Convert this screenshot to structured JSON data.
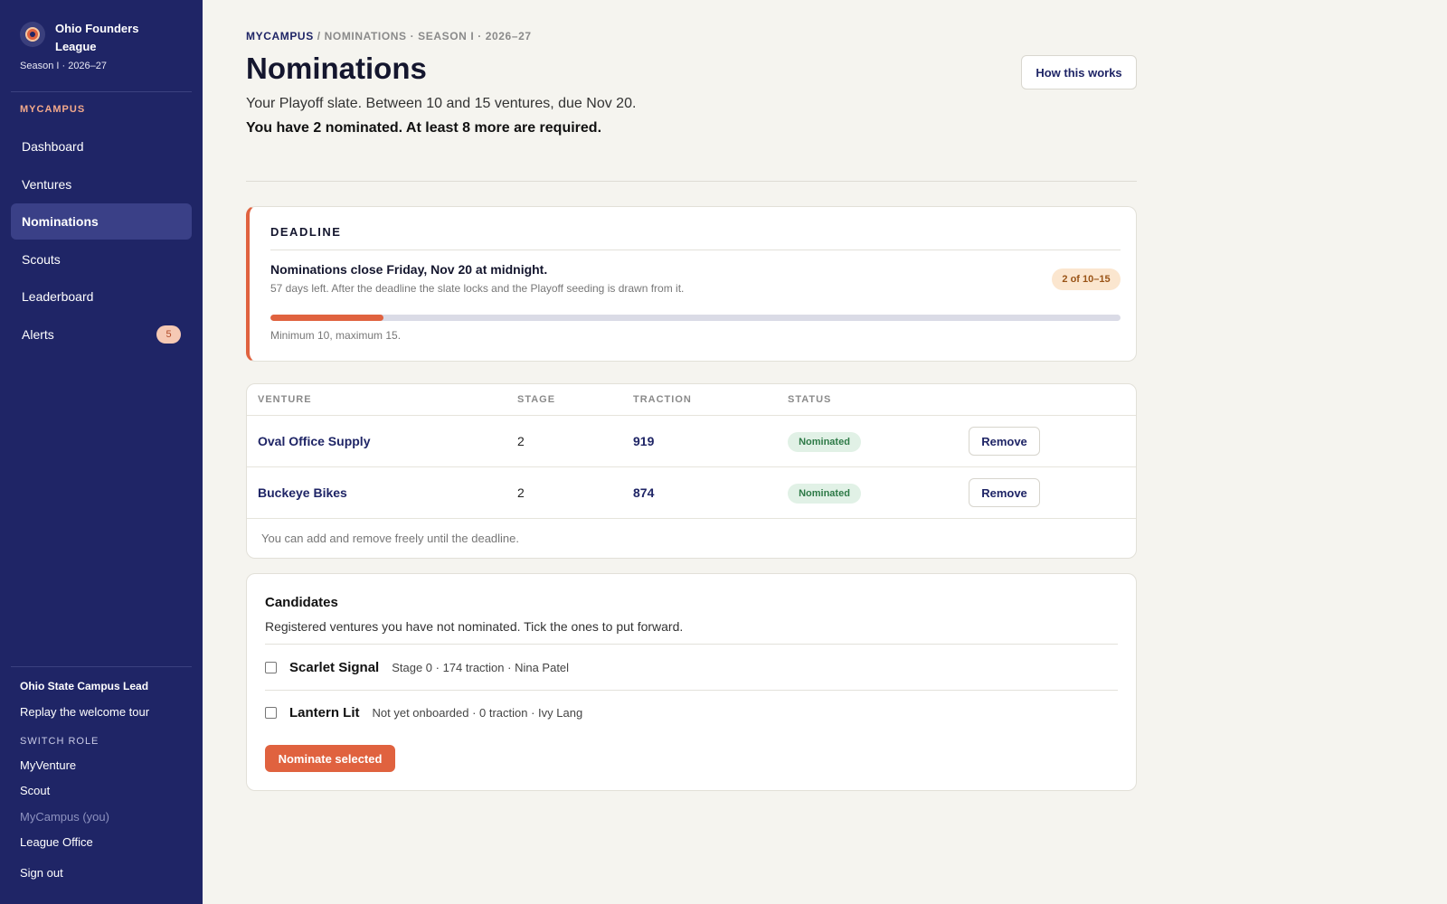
{
  "colors": {
    "sidebar_bg": "#1f2566",
    "accent": "#e0623f",
    "navy_text": "#1f2566",
    "status_green": "#2e7a47",
    "page_bg": "#f5f4ef"
  },
  "sidebar": {
    "brand_name": "Ohio Founders League",
    "brand_logo_icon": "league-shield-icon",
    "season": "Season I · 2026–27",
    "section_label": "MYCAMPUS",
    "nav": [
      {
        "label": "Dashboard",
        "active": false
      },
      {
        "label": "Ventures",
        "active": false
      },
      {
        "label": "Nominations",
        "active": true
      },
      {
        "label": "Scouts",
        "active": false
      },
      {
        "label": "Leaderboard",
        "active": false
      },
      {
        "label": "Alerts",
        "active": false,
        "badge": "5"
      }
    ],
    "role_name": "Ohio State Campus Lead",
    "replay_tour": "Replay the welcome tour",
    "switch_role_label": "SWITCH ROLE",
    "roles": [
      {
        "label": "MyVenture",
        "current": false
      },
      {
        "label": "Scout",
        "current": false
      },
      {
        "label": "MyCampus (you)",
        "current": true
      },
      {
        "label": "League Office",
        "current": false
      }
    ],
    "sign_out": "Sign out"
  },
  "header": {
    "breadcrumb_root": "MYCAMPUS",
    "breadcrumb_rest": "/ NOMINATIONS · SEASON I · 2026–27",
    "title": "Nominations",
    "how_button": "How this works",
    "subtitle": "Your Playoff slate. Between 10 and 15 ventures, due Nov 20.",
    "status_line": "You have 2 nominated. At least 8 more are required."
  },
  "deadline": {
    "label": "DEADLINE",
    "headline": "Nominations close Friday, Nov 20 at midnight.",
    "detail": "57 days left. After the deadline the slate locks and the Playoff seeding is drawn from it.",
    "count_pill": "2 of 10–15",
    "progress": 0.133,
    "note": "Minimum 10, maximum 15."
  },
  "nominations_table": {
    "columns": [
      "VENTURE",
      "STAGE",
      "TRACTION",
      "STATUS"
    ],
    "rows": [
      {
        "venture": "Oval Office Supply",
        "stage": "2",
        "traction": "919",
        "status": "Nominated",
        "action": "Remove"
      },
      {
        "venture": "Buckeye Bikes",
        "stage": "2",
        "traction": "874",
        "status": "Nominated",
        "action": "Remove"
      }
    ],
    "footer": "You can add and remove freely until the deadline."
  },
  "candidates": {
    "title": "Candidates",
    "subtitle": "Registered ventures you have not nominated. Tick the ones to put forward.",
    "items": [
      {
        "name": "Scarlet Signal",
        "meta": "Stage 0 · 174 traction · Nina Patel",
        "checked": false
      },
      {
        "name": "Lantern Lit",
        "meta": "Not yet onboarded · 0 traction · Ivy Lang",
        "checked": false
      }
    ],
    "submit_button": "Nominate selected"
  }
}
